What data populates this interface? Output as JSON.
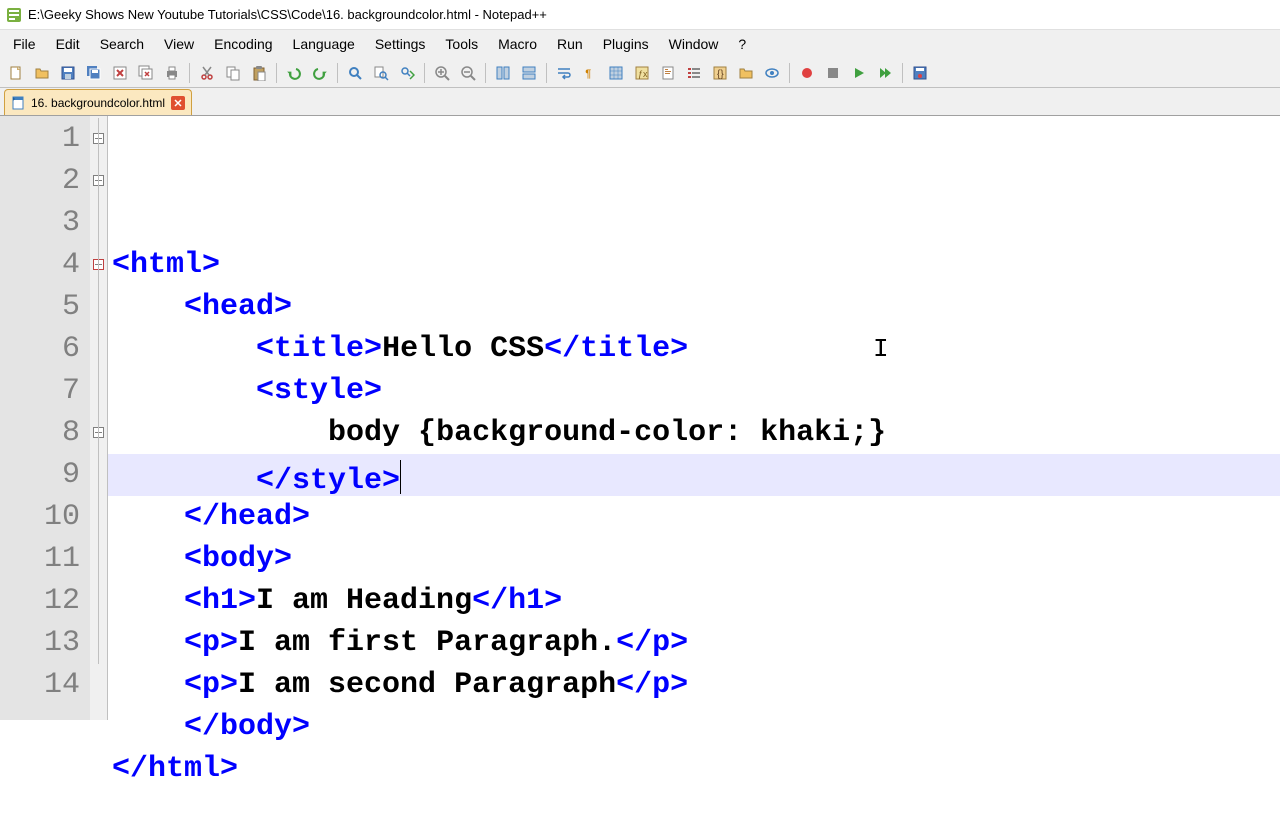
{
  "window": {
    "title": "E:\\Geeky Shows New Youtube Tutorials\\CSS\\Code\\16. backgroundcolor.html - Notepad++"
  },
  "menu": {
    "items": [
      "File",
      "Edit",
      "Search",
      "View",
      "Encoding",
      "Language",
      "Settings",
      "Tools",
      "Macro",
      "Run",
      "Plugins",
      "Window",
      "?"
    ]
  },
  "toolbar_icons": [
    "new",
    "open",
    "save",
    "save-all",
    "close",
    "close-all",
    "print",
    "sep",
    "cut",
    "copy",
    "paste",
    "sep",
    "undo",
    "redo",
    "sep",
    "find",
    "find-files",
    "find-next",
    "sep",
    "zoom-in",
    "zoom-out",
    "sep",
    "sync-v",
    "sync-h",
    "sep",
    "wordwrap",
    "show-all",
    "indent-guide",
    "lang",
    "doc-map",
    "doc-list",
    "func-list",
    "folder",
    "monitor",
    "sep",
    "record",
    "stop",
    "play",
    "play-multi",
    "sep",
    "macro-save"
  ],
  "tab": {
    "label": "16. backgroundcolor.html"
  },
  "code": {
    "lines": [
      {
        "n": 1,
        "indent": 0,
        "parts": [
          {
            "t": "tag",
            "v": "<html>"
          }
        ],
        "fold": "box"
      },
      {
        "n": 2,
        "indent": 1,
        "parts": [
          {
            "t": "tag",
            "v": "<head>"
          }
        ],
        "fold": "box"
      },
      {
        "n": 3,
        "indent": 2,
        "parts": [
          {
            "t": "tag",
            "v": "<title>"
          },
          {
            "t": "txt",
            "v": "Hello CSS"
          },
          {
            "t": "tag",
            "v": "</title>"
          }
        ]
      },
      {
        "n": 4,
        "indent": 2,
        "parts": [
          {
            "t": "tag",
            "v": "<style>"
          }
        ],
        "fold": "box-red"
      },
      {
        "n": 5,
        "indent": 3,
        "parts": [
          {
            "t": "txt",
            "v": "body {background-color: khaki;}"
          }
        ]
      },
      {
        "n": 6,
        "indent": 2,
        "parts": [
          {
            "t": "tag",
            "v": "</style>"
          }
        ],
        "hl": true,
        "cursor_after": true
      },
      {
        "n": 7,
        "indent": 1,
        "parts": [
          {
            "t": "tag",
            "v": "</head>"
          }
        ]
      },
      {
        "n": 8,
        "indent": 1,
        "parts": [
          {
            "t": "tag",
            "v": "<body>"
          }
        ],
        "fold": "box"
      },
      {
        "n": 9,
        "indent": 1,
        "parts": [
          {
            "t": "tag",
            "v": "<h1>"
          },
          {
            "t": "txt",
            "v": "I am Heading"
          },
          {
            "t": "tag",
            "v": "</h1>"
          }
        ]
      },
      {
        "n": 10,
        "indent": 1,
        "parts": [
          {
            "t": "tag",
            "v": "<p>"
          },
          {
            "t": "txt",
            "v": "I am first Paragraph."
          },
          {
            "t": "tag",
            "v": "</p>"
          }
        ]
      },
      {
        "n": 11,
        "indent": 1,
        "parts": [
          {
            "t": "tag",
            "v": "<p>"
          },
          {
            "t": "txt",
            "v": "I am second Paragraph"
          },
          {
            "t": "tag",
            "v": "</p>"
          }
        ]
      },
      {
        "n": 12,
        "indent": 1,
        "parts": [
          {
            "t": "tag",
            "v": "</body>"
          }
        ]
      },
      {
        "n": 13,
        "indent": 0,
        "parts": [
          {
            "t": "tag",
            "v": "</html>"
          }
        ]
      },
      {
        "n": 14,
        "indent": 0,
        "parts": []
      }
    ]
  },
  "cursor_marker_row": 6,
  "cursor_marker_col": 873
}
